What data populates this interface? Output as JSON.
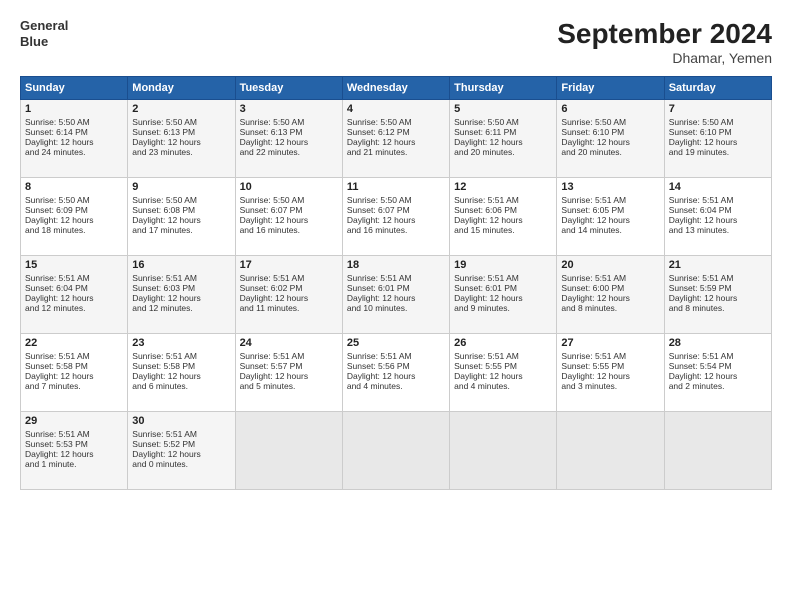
{
  "header": {
    "title": "September 2024",
    "subtitle": "Dhamar, Yemen",
    "logo_line1": "General",
    "logo_line2": "Blue"
  },
  "columns": [
    "Sunday",
    "Monday",
    "Tuesday",
    "Wednesday",
    "Thursday",
    "Friday",
    "Saturday"
  ],
  "weeks": [
    [
      {
        "day": "1",
        "lines": [
          "Sunrise: 5:50 AM",
          "Sunset: 6:14 PM",
          "Daylight: 12 hours",
          "and 24 minutes."
        ]
      },
      {
        "day": "2",
        "lines": [
          "Sunrise: 5:50 AM",
          "Sunset: 6:13 PM",
          "Daylight: 12 hours",
          "and 23 minutes."
        ]
      },
      {
        "day": "3",
        "lines": [
          "Sunrise: 5:50 AM",
          "Sunset: 6:13 PM",
          "Daylight: 12 hours",
          "and 22 minutes."
        ]
      },
      {
        "day": "4",
        "lines": [
          "Sunrise: 5:50 AM",
          "Sunset: 6:12 PM",
          "Daylight: 12 hours",
          "and 21 minutes."
        ]
      },
      {
        "day": "5",
        "lines": [
          "Sunrise: 5:50 AM",
          "Sunset: 6:11 PM",
          "Daylight: 12 hours",
          "and 20 minutes."
        ]
      },
      {
        "day": "6",
        "lines": [
          "Sunrise: 5:50 AM",
          "Sunset: 6:10 PM",
          "Daylight: 12 hours",
          "and 20 minutes."
        ]
      },
      {
        "day": "7",
        "lines": [
          "Sunrise: 5:50 AM",
          "Sunset: 6:10 PM",
          "Daylight: 12 hours",
          "and 19 minutes."
        ]
      }
    ],
    [
      {
        "day": "8",
        "lines": [
          "Sunrise: 5:50 AM",
          "Sunset: 6:09 PM",
          "Daylight: 12 hours",
          "and 18 minutes."
        ]
      },
      {
        "day": "9",
        "lines": [
          "Sunrise: 5:50 AM",
          "Sunset: 6:08 PM",
          "Daylight: 12 hours",
          "and 17 minutes."
        ]
      },
      {
        "day": "10",
        "lines": [
          "Sunrise: 5:50 AM",
          "Sunset: 6:07 PM",
          "Daylight: 12 hours",
          "and 16 minutes."
        ]
      },
      {
        "day": "11",
        "lines": [
          "Sunrise: 5:50 AM",
          "Sunset: 6:07 PM",
          "Daylight: 12 hours",
          "and 16 minutes."
        ]
      },
      {
        "day": "12",
        "lines": [
          "Sunrise: 5:51 AM",
          "Sunset: 6:06 PM",
          "Daylight: 12 hours",
          "and 15 minutes."
        ]
      },
      {
        "day": "13",
        "lines": [
          "Sunrise: 5:51 AM",
          "Sunset: 6:05 PM",
          "Daylight: 12 hours",
          "and 14 minutes."
        ]
      },
      {
        "day": "14",
        "lines": [
          "Sunrise: 5:51 AM",
          "Sunset: 6:04 PM",
          "Daylight: 12 hours",
          "and 13 minutes."
        ]
      }
    ],
    [
      {
        "day": "15",
        "lines": [
          "Sunrise: 5:51 AM",
          "Sunset: 6:04 PM",
          "Daylight: 12 hours",
          "and 12 minutes."
        ]
      },
      {
        "day": "16",
        "lines": [
          "Sunrise: 5:51 AM",
          "Sunset: 6:03 PM",
          "Daylight: 12 hours",
          "and 12 minutes."
        ]
      },
      {
        "day": "17",
        "lines": [
          "Sunrise: 5:51 AM",
          "Sunset: 6:02 PM",
          "Daylight: 12 hours",
          "and 11 minutes."
        ]
      },
      {
        "day": "18",
        "lines": [
          "Sunrise: 5:51 AM",
          "Sunset: 6:01 PM",
          "Daylight: 12 hours",
          "and 10 minutes."
        ]
      },
      {
        "day": "19",
        "lines": [
          "Sunrise: 5:51 AM",
          "Sunset: 6:01 PM",
          "Daylight: 12 hours",
          "and 9 minutes."
        ]
      },
      {
        "day": "20",
        "lines": [
          "Sunrise: 5:51 AM",
          "Sunset: 6:00 PM",
          "Daylight: 12 hours",
          "and 8 minutes."
        ]
      },
      {
        "day": "21",
        "lines": [
          "Sunrise: 5:51 AM",
          "Sunset: 5:59 PM",
          "Daylight: 12 hours",
          "and 8 minutes."
        ]
      }
    ],
    [
      {
        "day": "22",
        "lines": [
          "Sunrise: 5:51 AM",
          "Sunset: 5:58 PM",
          "Daylight: 12 hours",
          "and 7 minutes."
        ]
      },
      {
        "day": "23",
        "lines": [
          "Sunrise: 5:51 AM",
          "Sunset: 5:58 PM",
          "Daylight: 12 hours",
          "and 6 minutes."
        ]
      },
      {
        "day": "24",
        "lines": [
          "Sunrise: 5:51 AM",
          "Sunset: 5:57 PM",
          "Daylight: 12 hours",
          "and 5 minutes."
        ]
      },
      {
        "day": "25",
        "lines": [
          "Sunrise: 5:51 AM",
          "Sunset: 5:56 PM",
          "Daylight: 12 hours",
          "and 4 minutes."
        ]
      },
      {
        "day": "26",
        "lines": [
          "Sunrise: 5:51 AM",
          "Sunset: 5:55 PM",
          "Daylight: 12 hours",
          "and 4 minutes."
        ]
      },
      {
        "day": "27",
        "lines": [
          "Sunrise: 5:51 AM",
          "Sunset: 5:55 PM",
          "Daylight: 12 hours",
          "and 3 minutes."
        ]
      },
      {
        "day": "28",
        "lines": [
          "Sunrise: 5:51 AM",
          "Sunset: 5:54 PM",
          "Daylight: 12 hours",
          "and 2 minutes."
        ]
      }
    ],
    [
      {
        "day": "29",
        "lines": [
          "Sunrise: 5:51 AM",
          "Sunset: 5:53 PM",
          "Daylight: 12 hours",
          "and 1 minute."
        ]
      },
      {
        "day": "30",
        "lines": [
          "Sunrise: 5:51 AM",
          "Sunset: 5:52 PM",
          "Daylight: 12 hours",
          "and 0 minutes."
        ]
      },
      {
        "day": "",
        "lines": []
      },
      {
        "day": "",
        "lines": []
      },
      {
        "day": "",
        "lines": []
      },
      {
        "day": "",
        "lines": []
      },
      {
        "day": "",
        "lines": []
      }
    ]
  ]
}
